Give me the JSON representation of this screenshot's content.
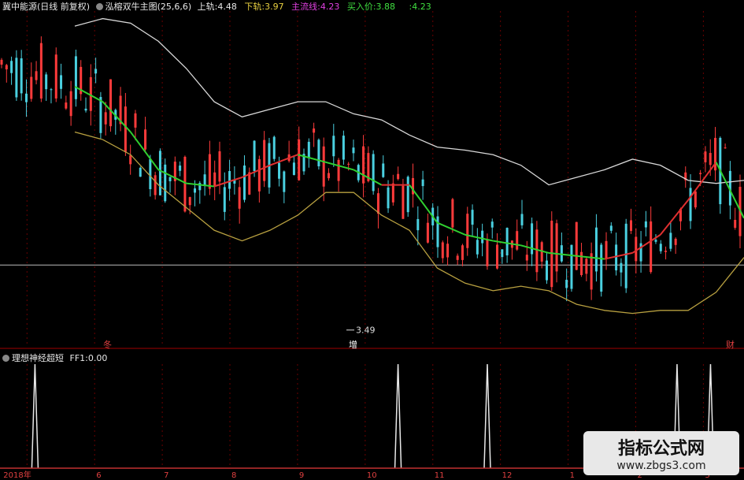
{
  "main_header": {
    "stock_name": "冀中能源(日线 前复权)",
    "indicator_name": "泓榕双牛主图(25,6,6)",
    "upper_label": "上轨:",
    "upper_value": "4.48",
    "lower_label": "下轨:",
    "lower_value": "3.97",
    "main_label": "主流线:",
    "main_value": "4.23",
    "buy_label": "买入价:",
    "buy_value": "3.88",
    "last_value": ":4.23"
  },
  "sub_header": {
    "indicator_name": "理想神经超短",
    "ff_label": "FF1:",
    "ff_value": "0.00"
  },
  "low_label": "3.49",
  "marker_labels": [
    "冬",
    "增",
    "财"
  ],
  "x_ticks": [
    "2018年",
    "6",
    "7",
    "8",
    "9",
    "10",
    "11",
    "12",
    "1",
    "2",
    "3"
  ],
  "watermark": {
    "line1": "指标公式网",
    "line2": "www.zbgs3.com"
  },
  "colors": {
    "bg": "#000000",
    "up": "#ff3b3b",
    "down": "#4ad0e0",
    "upper_band": "#d8d8d8",
    "lower_band": "#b8a040",
    "main_up": "#e03030",
    "main_down": "#30d030",
    "grid": "#6a0000",
    "baseline": "#bbbbbb",
    "spike": "#e8e8e8"
  },
  "chart_data": [
    {
      "type": "candlestick",
      "title": "泓榕双牛主图(25,6,6)",
      "ylim": [
        3.4,
        5.6
      ],
      "reference_price": 3.92,
      "annotation": {
        "label": "3.49",
        "value": 3.49
      },
      "series": [
        {
          "name": "上轨",
          "last": 4.48,
          "values": [
            5.5,
            5.55,
            5.52,
            5.4,
            5.22,
            5.0,
            4.9,
            4.95,
            5.0,
            5.0,
            4.92,
            4.88,
            4.78,
            4.7,
            4.68,
            4.65,
            4.58,
            4.45,
            4.5,
            4.55,
            4.62,
            4.58,
            4.48,
            4.46,
            4.48
          ]
        },
        {
          "name": "下轨",
          "last": 3.97,
          "values": [
            4.8,
            4.75,
            4.65,
            4.45,
            4.3,
            4.15,
            4.08,
            4.15,
            4.25,
            4.4,
            4.4,
            4.25,
            4.15,
            3.9,
            3.8,
            3.75,
            3.78,
            3.75,
            3.66,
            3.62,
            3.6,
            3.62,
            3.62,
            3.74,
            3.97
          ]
        },
        {
          "name": "主流线",
          "last": 4.23,
          "values": [
            5.1,
            5.0,
            4.8,
            4.55,
            4.46,
            4.44,
            4.5,
            4.58,
            4.65,
            4.6,
            4.55,
            4.45,
            4.45,
            4.2,
            4.12,
            4.08,
            4.05,
            4.0,
            3.98,
            3.96,
            4.0,
            4.12,
            4.35,
            4.6,
            4.23
          ]
        },
        {
          "name": "买入价",
          "last": 3.88
        }
      ]
    },
    {
      "type": "line",
      "title": "理想神经超短",
      "ylim": [
        0,
        1
      ],
      "series": [
        {
          "name": "FF1",
          "last": 0.0,
          "spikes_at_fraction": [
            0.047,
            0.535,
            0.655,
            0.91,
            0.955
          ],
          "values": [
            0,
            1,
            0,
            1,
            0,
            1,
            0,
            1,
            0,
            1,
            0
          ]
        }
      ]
    }
  ]
}
